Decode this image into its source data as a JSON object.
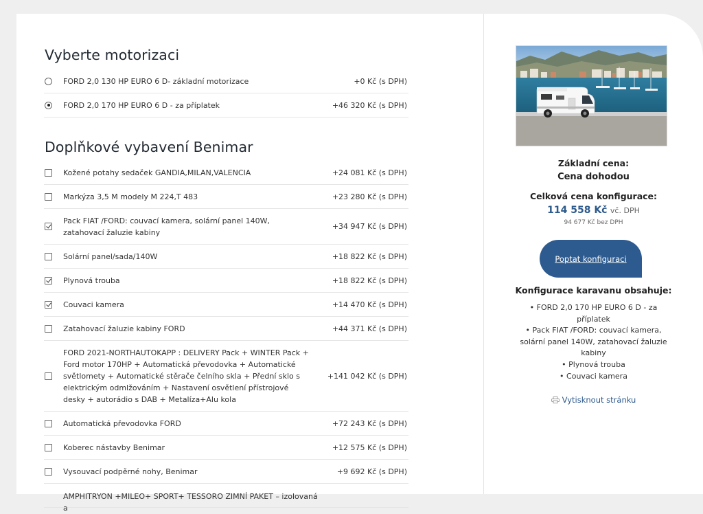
{
  "engine": {
    "title": "Vyberte motorizaci",
    "options": [
      {
        "name": "FORD 2,0 130 HP EURO 6 D- základní motorizace",
        "price": "+0 Kč (s DPH)",
        "selected": false
      },
      {
        "name": "FORD 2,0 170 HP EURO 6 D - za příplatek",
        "price": "+46 320 Kč (s DPH)",
        "selected": true
      }
    ]
  },
  "extras": {
    "title": "Doplňkové vybavení Benimar",
    "options": [
      {
        "name": "Kožené potahy sedaček GANDIA,MILAN,VALENCIA",
        "price": "+24 081 Kč (s DPH)",
        "checked": false
      },
      {
        "name": "Markýza 3,5 M modely M 224,T 483",
        "price": "+23 280 Kč (s DPH)",
        "checked": false
      },
      {
        "name": "Pack FIAT /FORD: couvací kamera, solární panel 140W, zatahovací žaluzie kabiny",
        "price": "+34 947 Kč (s DPH)",
        "checked": true
      },
      {
        "name": "Solární panel/sada/140W",
        "price": "+18 822 Kč (s DPH)",
        "checked": false
      },
      {
        "name": "Plynová trouba",
        "price": "+18 822 Kč (s DPH)",
        "checked": true
      },
      {
        "name": "Couvaci kamera",
        "price": "+14 470 Kč (s DPH)",
        "checked": true
      },
      {
        "name": "Zatahovací žaluzie kabiny FORD",
        "price": "+44 371 Kč (s DPH)",
        "checked": false
      },
      {
        "name": "FORD 2021-NORTHAUTOKAPP : DELIVERY Pack + WINTER Pack + Ford motor 170HP + Automatická převodovka + Automatické světlomety + Automatické stěrače čelního skla + Přední sklo s elektrickým odmlžováním + Nastavení osvětlení přístrojové desky + autorádio s DAB + Metalíza+Alu kola",
        "price": "+141 042 Kč (s DPH)",
        "checked": false
      },
      {
        "name": "Automatická převodovka FORD",
        "price": "+72 243 Kč (s DPH)",
        "checked": false
      },
      {
        "name": "Koberec nástavby Benimar",
        "price": "+12 575 Kč (s DPH)",
        "checked": false
      },
      {
        "name": "Vysouvací podpěrné nohy, Benimar",
        "price": "+9 692 Kč (s DPH)",
        "checked": false
      },
      {
        "name": "AMPHITRYON +MILEO+ SPORT+ TESSORO ZIMNÍ PAKET – izolovaná a",
        "price": "",
        "checked": false
      }
    ]
  },
  "summary": {
    "base_label": "Základní cena:",
    "base_value": "Cena dohodou",
    "total_label": "Celková cena konfigurace:",
    "total_price": "114 558 Kč",
    "total_vat_note": "vč. DPH",
    "net_price": "94 677 Kč bez DPH",
    "cta_label": "Poptat konfiguraci",
    "contains_title": "Konfigurace karavanu obsahuje:",
    "contains": [
      "FORD 2,0 170 HP EURO 6 D - za příplatek",
      "Pack FIAT /FORD: couvací kamera, solární panel 140W, zatahovací žaluzie kabiny",
      "Plynová trouba",
      "Couvaci kamera"
    ],
    "print_label": "Vytisknout stránku"
  },
  "colors": {
    "accent": "#2e5b8f",
    "page_bg": "#efefef",
    "panel_bg": "#ffffff"
  }
}
